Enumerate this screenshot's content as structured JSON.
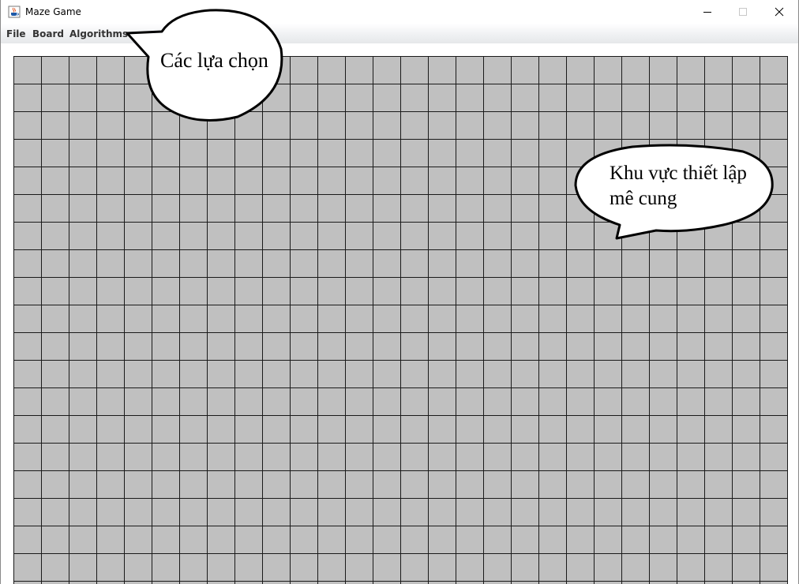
{
  "window": {
    "title": "Maze Game",
    "icons": {
      "app": "java-cup-icon",
      "minimize": "minimize-icon",
      "maximize": "maximize-icon",
      "close": "close-icon"
    }
  },
  "menu": {
    "items": [
      {
        "label": "File"
      },
      {
        "label": "Board"
      },
      {
        "label": "Algorithms"
      }
    ]
  },
  "board": {
    "columns": 28,
    "rows": 19,
    "cell_color": "#c0c0c0",
    "line_color": "#1a1a1a"
  },
  "annotations": {
    "menu_callout": "Các lựa chọn",
    "board_callout_line1": "Khu vực thiết lập",
    "board_callout_line2": "mê cung"
  }
}
